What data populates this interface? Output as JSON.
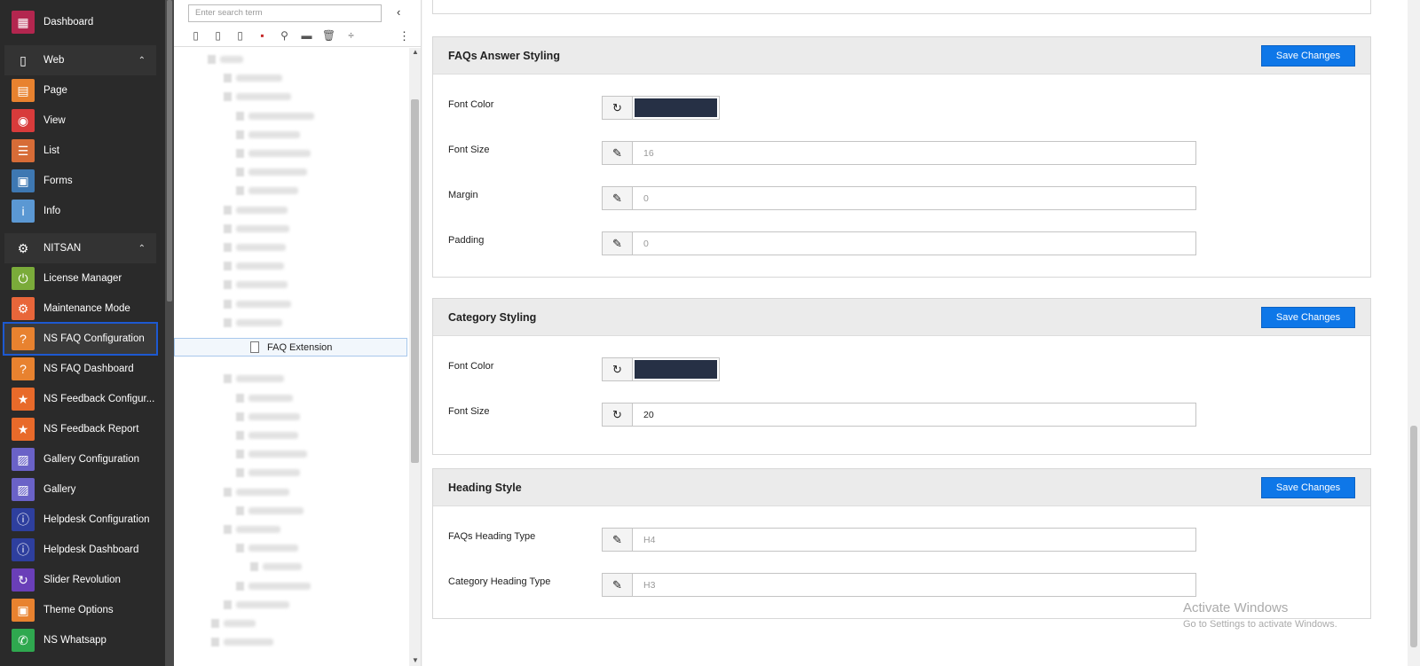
{
  "modmenu": {
    "items": [
      {
        "label": "Dashboard",
        "icon": "dashboard-icon",
        "glyph": "▦",
        "color": "#b3264f"
      },
      {
        "label": "Web",
        "icon": "file-icon",
        "glyph": "▯",
        "color": "transparent",
        "group": true
      },
      {
        "label": "Page",
        "icon": "page-icon",
        "glyph": "▤",
        "color": "#e8822f"
      },
      {
        "label": "View",
        "icon": "eye-icon",
        "glyph": "◉",
        "color": "#d83b3b"
      },
      {
        "label": "List",
        "icon": "list-icon",
        "glyph": "☰",
        "color": "#d76c37"
      },
      {
        "label": "Forms",
        "icon": "forms-icon",
        "glyph": "▣",
        "color": "#3e78b2"
      },
      {
        "label": "Info",
        "icon": "info-icon",
        "glyph": "i",
        "color": "#5b98d3"
      },
      {
        "label": "NITSAN",
        "icon": "gear-icon",
        "glyph": "⚙",
        "color": "transparent",
        "group": true
      },
      {
        "label": "License Manager",
        "icon": "power-icon",
        "glyph": "⏻",
        "color": "#7aab3a"
      },
      {
        "label": "Maintenance Mode",
        "icon": "cog-badge-icon",
        "glyph": "⚙",
        "color": "#e8663a"
      },
      {
        "label": "NS FAQ Configuration",
        "icon": "faq-icon",
        "glyph": "?",
        "color": "#e8822f",
        "active": true
      },
      {
        "label": "NS FAQ Dashboard",
        "icon": "faq-icon",
        "glyph": "?",
        "color": "#e8822f"
      },
      {
        "label": "NS Feedback Configur...",
        "icon": "star-icon",
        "glyph": "★",
        "color": "#e86a2a"
      },
      {
        "label": "NS Feedback Report",
        "icon": "star-icon",
        "glyph": "★",
        "color": "#e86a2a"
      },
      {
        "label": "Gallery Configuration",
        "icon": "image-icon",
        "glyph": "▨",
        "color": "#6a62c7"
      },
      {
        "label": "Gallery",
        "icon": "image-icon",
        "glyph": "▨",
        "color": "#6a62c7"
      },
      {
        "label": "Helpdesk Configuration",
        "icon": "info-circle-icon",
        "glyph": "ⓘ",
        "color": "#2e3f9e"
      },
      {
        "label": "Helpdesk Dashboard",
        "icon": "info-circle-icon",
        "glyph": "ⓘ",
        "color": "#2e3f9e"
      },
      {
        "label": "Slider Revolution",
        "icon": "refresh-icon",
        "glyph": "↻",
        "color": "#6a3fb8"
      },
      {
        "label": "Theme Options",
        "icon": "box-icon",
        "glyph": "▣",
        "color": "#e8822f"
      },
      {
        "label": "NS Whatsapp",
        "icon": "whatsapp-icon",
        "glyph": "✆",
        "color": "#2fa84f"
      }
    ]
  },
  "tree": {
    "search_placeholder": "Enter search term",
    "selected_node": "FAQ Extension"
  },
  "content": {
    "cards": [
      {
        "title": "FAQs Answer Styling",
        "save": "Save Changes",
        "rows": [
          {
            "label": "Font Color",
            "type": "color",
            "btn": "↻",
            "btn_icon": "reset-icon",
            "value": "#263045"
          },
          {
            "label": "Font Size",
            "type": "text",
            "btn": "✎",
            "btn_icon": "pencil-icon",
            "value": "16",
            "placeholder": true
          },
          {
            "label": "Margin",
            "type": "text",
            "btn": "✎",
            "btn_icon": "pencil-icon",
            "value": "0",
            "placeholder": true
          },
          {
            "label": "Padding",
            "type": "text",
            "btn": "✎",
            "btn_icon": "pencil-icon",
            "value": "0",
            "placeholder": true
          }
        ]
      },
      {
        "title": "Category Styling",
        "save": "Save Changes",
        "rows": [
          {
            "label": "Font Color",
            "type": "color",
            "btn": "↻",
            "btn_icon": "reset-icon",
            "value": "#263045"
          },
          {
            "label": "Font Size",
            "type": "text",
            "btn": "↻",
            "btn_icon": "reset-icon",
            "value": "20",
            "placeholder": false
          }
        ]
      },
      {
        "title": "Heading Style",
        "save": "Save Changes",
        "rows": [
          {
            "label": "FAQs Heading Type",
            "type": "text",
            "btn": "✎",
            "btn_icon": "pencil-icon",
            "value": "H4",
            "placeholder": true
          },
          {
            "label": "Category Heading Type",
            "type": "text",
            "btn": "✎",
            "btn_icon": "pencil-icon",
            "value": "H3",
            "placeholder": true
          }
        ]
      }
    ]
  },
  "watermark": {
    "line1": "Activate Windows",
    "line2": "Go to Settings to activate Windows."
  }
}
